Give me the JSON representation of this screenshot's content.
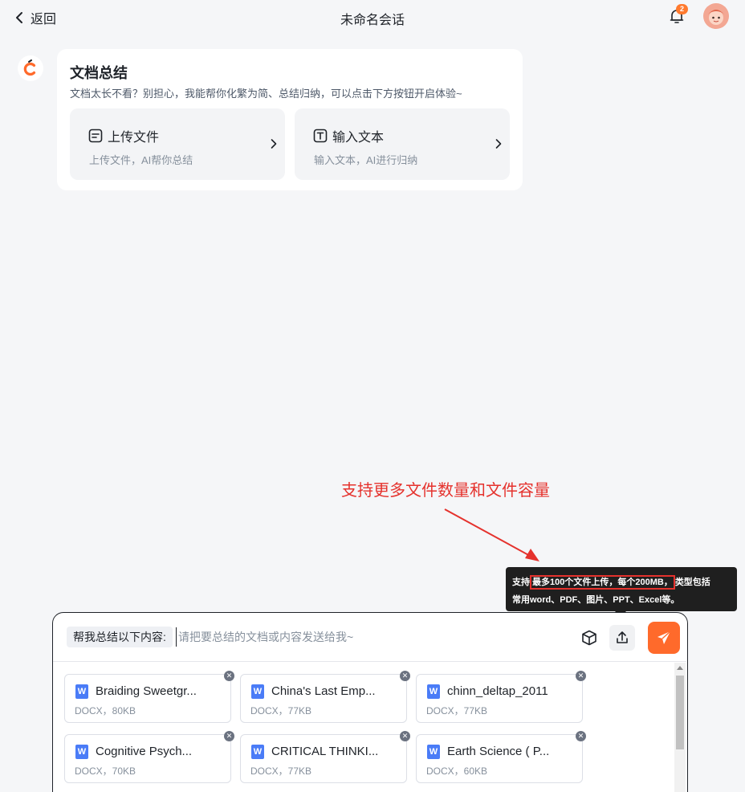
{
  "header": {
    "back_label": "返回",
    "title": "未命名会话",
    "notification_count": "2"
  },
  "intro": {
    "title": "文档总结",
    "description": "文档太长不看？别担心，我能帮你化繁为简、总结归纳，可以点击下方按钮开启体验~",
    "options": [
      {
        "label": "上传文件",
        "sub": "上传文件，AI帮你总结",
        "icon": "doc-lines-icon"
      },
      {
        "label": "输入文本",
        "sub": "输入文本，AI进行归纳",
        "icon": "text-t-icon"
      }
    ]
  },
  "annotation": {
    "text": "支持更多文件数量和文件容量",
    "color": "#e5322d"
  },
  "tooltip": {
    "prefix": "支持",
    "highlight": "最多100个文件上传，每个200MB，",
    "suffix": "类型包括",
    "line2": "常用word、PDF、图片、PPT、Excel等。"
  },
  "input": {
    "prefix_tag": "帮我总结以下内容:",
    "placeholder": "请把要总结的文档或内容发送给我~"
  },
  "files": [
    {
      "name": "Braiding Sweetgr...",
      "meta": "DOCX，80KB"
    },
    {
      "name": "China's Last Emp...",
      "meta": "DOCX，77KB"
    },
    {
      "name": "chinn_deltap_2011",
      "meta": "DOCX，77KB"
    },
    {
      "name": "Cognitive Psych...",
      "meta": "DOCX，70KB"
    },
    {
      "name": "CRITICAL THINKI...",
      "meta": "DOCX，77KB"
    },
    {
      "name": "Earth Science ( P...",
      "meta": "DOCX，60KB"
    }
  ],
  "colors": {
    "accent": "#ff6a2b",
    "word_blue": "#4a7cf7"
  }
}
